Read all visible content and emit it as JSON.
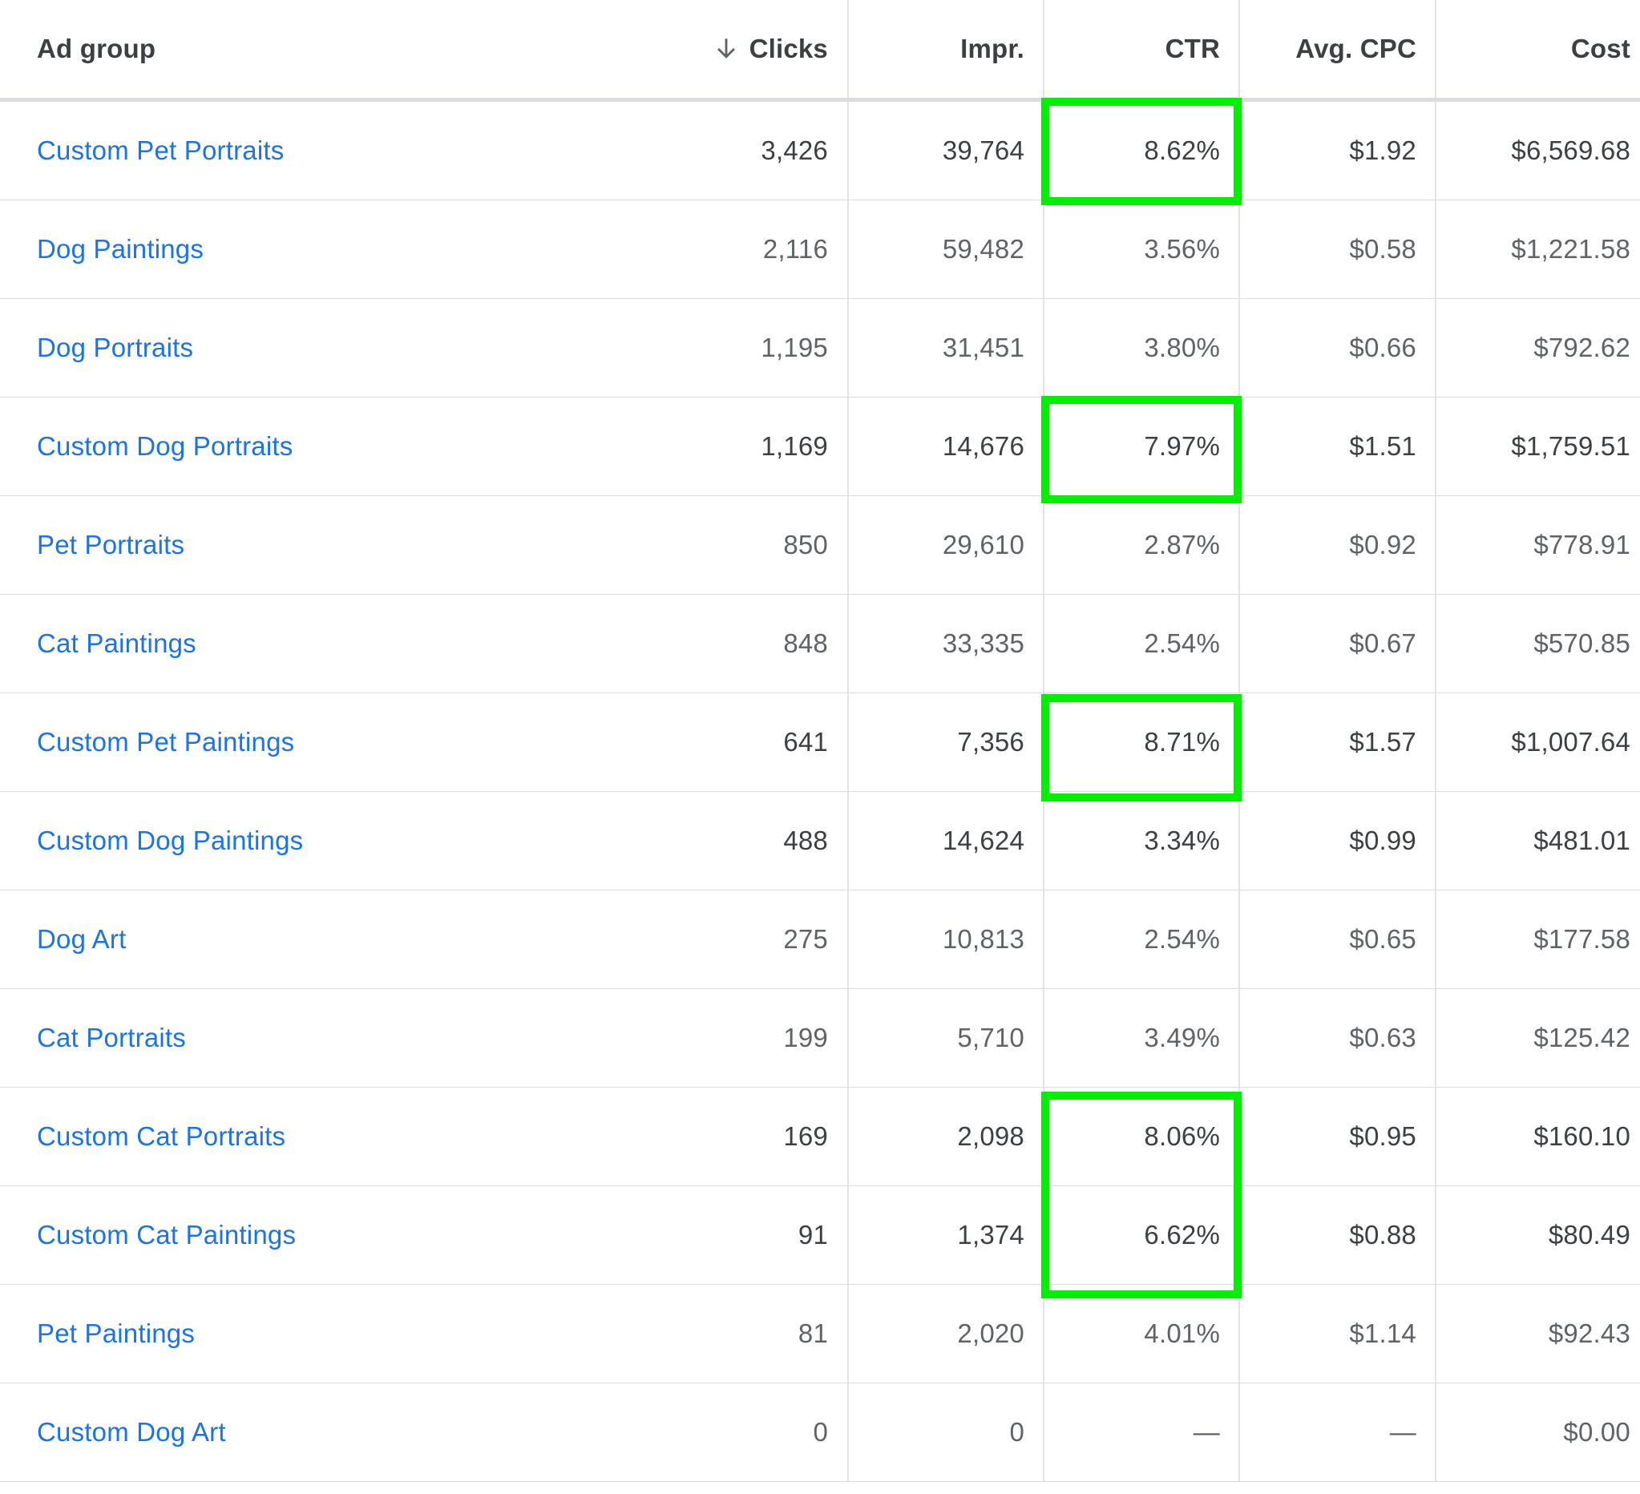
{
  "table": {
    "columns": {
      "ad_group": "Ad group",
      "clicks": "Clicks",
      "impr": "Impr.",
      "ctr": "CTR",
      "avg_cpc": "Avg. CPC",
      "cost": "Cost"
    },
    "sort": {
      "column": "Clicks",
      "direction": "descending",
      "icon": "arrow-down-icon"
    },
    "rows": [
      {
        "ad_group": "Custom Pet Portraits",
        "clicks": "3,426",
        "impr": "39,764",
        "ctr": "8.62%",
        "avg_cpc": "$1.92",
        "cost": "$6,569.68",
        "emphasized": true,
        "highlighted": true
      },
      {
        "ad_group": "Dog Paintings",
        "clicks": "2,116",
        "impr": "59,482",
        "ctr": "3.56%",
        "avg_cpc": "$0.58",
        "cost": "$1,221.58",
        "emphasized": false,
        "highlighted": false
      },
      {
        "ad_group": "Dog Portraits",
        "clicks": "1,195",
        "impr": "31,451",
        "ctr": "3.80%",
        "avg_cpc": "$0.66",
        "cost": "$792.62",
        "emphasized": false,
        "highlighted": false
      },
      {
        "ad_group": "Custom Dog Portraits",
        "clicks": "1,169",
        "impr": "14,676",
        "ctr": "7.97%",
        "avg_cpc": "$1.51",
        "cost": "$1,759.51",
        "emphasized": true,
        "highlighted": true
      },
      {
        "ad_group": "Pet Portraits",
        "clicks": "850",
        "impr": "29,610",
        "ctr": "2.87%",
        "avg_cpc": "$0.92",
        "cost": "$778.91",
        "emphasized": false,
        "highlighted": false
      },
      {
        "ad_group": "Cat Paintings",
        "clicks": "848",
        "impr": "33,335",
        "ctr": "2.54%",
        "avg_cpc": "$0.67",
        "cost": "$570.85",
        "emphasized": false,
        "highlighted": false
      },
      {
        "ad_group": "Custom Pet Paintings",
        "clicks": "641",
        "impr": "7,356",
        "ctr": "8.71%",
        "avg_cpc": "$1.57",
        "cost": "$1,007.64",
        "emphasized": true,
        "highlighted": true
      },
      {
        "ad_group": "Custom Dog Paintings",
        "clicks": "488",
        "impr": "14,624",
        "ctr": "3.34%",
        "avg_cpc": "$0.99",
        "cost": "$481.01",
        "emphasized": true,
        "highlighted": false
      },
      {
        "ad_group": "Dog Art",
        "clicks": "275",
        "impr": "10,813",
        "ctr": "2.54%",
        "avg_cpc": "$0.65",
        "cost": "$177.58",
        "emphasized": false,
        "highlighted": false
      },
      {
        "ad_group": "Cat Portraits",
        "clicks": "199",
        "impr": "5,710",
        "ctr": "3.49%",
        "avg_cpc": "$0.63",
        "cost": "$125.42",
        "emphasized": false,
        "highlighted": false
      },
      {
        "ad_group": "Custom Cat Portraits",
        "clicks": "169",
        "impr": "2,098",
        "ctr": "8.06%",
        "avg_cpc": "$0.95",
        "cost": "$160.10",
        "emphasized": true,
        "highlighted": true
      },
      {
        "ad_group": "Custom Cat Paintings",
        "clicks": "91",
        "impr": "1,374",
        "ctr": "6.62%",
        "avg_cpc": "$0.88",
        "cost": "$80.49",
        "emphasized": true,
        "highlighted": true
      },
      {
        "ad_group": "Pet Paintings",
        "clicks": "81",
        "impr": "2,020",
        "ctr": "4.01%",
        "avg_cpc": "$1.14",
        "cost": "$92.43",
        "emphasized": false,
        "highlighted": false
      },
      {
        "ad_group": "Custom Dog Art",
        "clicks": "0",
        "impr": "0",
        "ctr": "—",
        "avg_cpc": "—",
        "cost": "$0.00",
        "emphasized": false,
        "highlighted": false
      }
    ]
  },
  "highlight_groups": [
    {
      "rows": [
        0
      ],
      "color": "#00f000"
    },
    {
      "rows": [
        3
      ],
      "color": "#00f000"
    },
    {
      "rows": [
        6
      ],
      "color": "#00f000"
    },
    {
      "rows": [
        10,
        11
      ],
      "color": "#00f000"
    }
  ],
  "colors": {
    "link": "#1a73e8",
    "text_primary": "#3c4043",
    "text_secondary": "#5f6368",
    "grid": "#dadce0",
    "highlight": "#00f000"
  }
}
